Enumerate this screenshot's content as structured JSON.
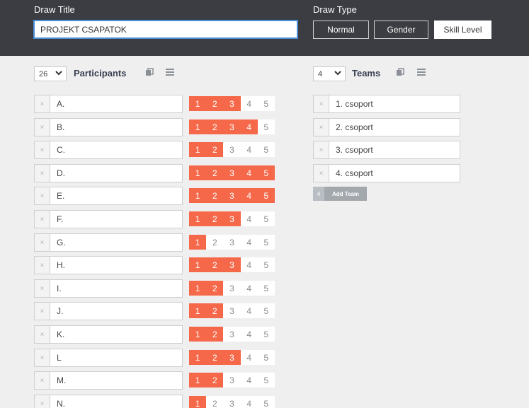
{
  "header": {
    "draw_title_label": "Draw Title",
    "draw_title_value": "PROJEKT CSAPATOK",
    "draw_type_label": "Draw Type",
    "draw_type_options": [
      "Normal",
      "Gender",
      "Skill Level"
    ],
    "draw_type_selected": "Skill Level"
  },
  "participants": {
    "count": "26",
    "title": "Participants",
    "skill_levels": [
      "1",
      "2",
      "3",
      "4",
      "5"
    ],
    "items": [
      {
        "name": "A.",
        "skill": 3
      },
      {
        "name": "B.",
        "skill": 4
      },
      {
        "name": "C.",
        "skill": 2
      },
      {
        "name": "D.",
        "skill": 5
      },
      {
        "name": "E.",
        "skill": 5
      },
      {
        "name": "F.",
        "skill": 3
      },
      {
        "name": "G.",
        "skill": 1
      },
      {
        "name": "H.",
        "skill": 3
      },
      {
        "name": "I.",
        "skill": 2
      },
      {
        "name": "J.",
        "skill": 2
      },
      {
        "name": "K.",
        "skill": 2
      },
      {
        "name": "L",
        "skill": 3
      },
      {
        "name": "M.",
        "skill": 2
      },
      {
        "name": "N.",
        "skill": 1
      }
    ]
  },
  "teams": {
    "count": "4",
    "title": "Teams",
    "items": [
      "1. csoport",
      "2. csoport",
      "3. csoport",
      "4. csoport"
    ],
    "add_count": "4",
    "add_label": "Add Team"
  },
  "icons": {
    "remove": "×",
    "chevron": "❯"
  },
  "colors": {
    "header_bg": "#3b3d42",
    "skill_on": "#f5694a",
    "focus": "#4a90d9"
  }
}
